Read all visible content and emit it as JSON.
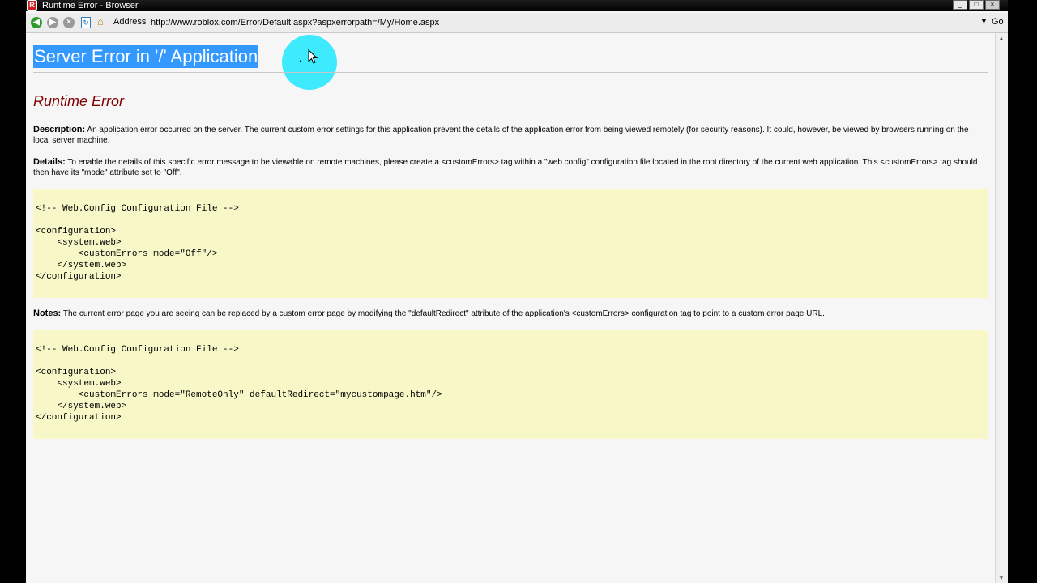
{
  "window": {
    "title": "Runtime Error - Browser",
    "controls": {
      "minimize": "_",
      "maximize": "□",
      "close": "×"
    }
  },
  "toolbar": {
    "address_label": "Address",
    "url": "http://www.roblox.com/Error/Default.aspx?aspxerrorpath=/My/Home.aspx",
    "go_label": "Go"
  },
  "page": {
    "title_selected": "Server Error in '/' Application",
    "title_tail": ".",
    "section_heading": "Runtime Error",
    "description_label": "Description:",
    "description_text": " An application error occurred on the server. The current custom error settings for this application prevent the details of the application error from being viewed remotely (for security reasons). It could, however, be viewed by browsers running on the local server machine.",
    "details_label": "Details:",
    "details_text": " To enable the details of this specific error message to be viewable on remote machines, please create a <customErrors> tag within a \"web.config\" configuration file located in the root directory of the current web application. This <customErrors> tag should then have its \"mode\" attribute set to \"Off\".",
    "code1": "<!-- Web.Config Configuration File -->\n\n<configuration>\n    <system.web>\n        <customErrors mode=\"Off\"/>\n    </system.web>\n</configuration>",
    "notes_label": "Notes:",
    "notes_text": " The current error page you are seeing can be replaced by a custom error page by modifying the \"defaultRedirect\" attribute of the application's <customErrors> configuration tag to point to a custom error page URL.",
    "code2": "<!-- Web.Config Configuration File -->\n\n<configuration>\n    <system.web>\n        <customErrors mode=\"RemoteOnly\" defaultRedirect=\"mycustompage.htm\"/>\n    </system.web>\n</configuration>"
  },
  "colors": {
    "selection": "#3399ff",
    "heading": "#800000",
    "code_background": "#f7f7c8",
    "cursor_highlight": "#00e6ff"
  }
}
